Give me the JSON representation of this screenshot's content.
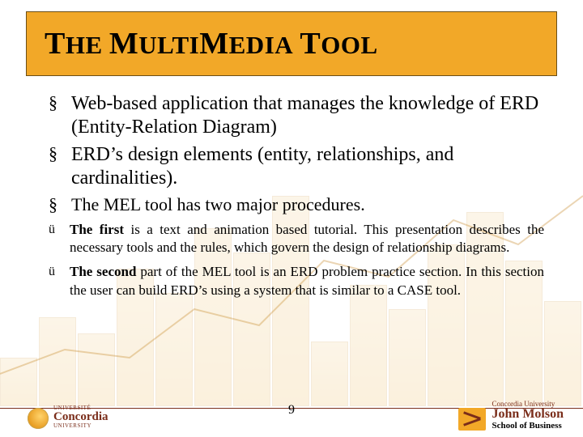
{
  "title_plain": "THE MULTIMEDIA TOOL",
  "bullets_main": [
    "Web-based application that manages the knowledge of ERD (Entity-Relation Diagram)",
    "ERD’s design elements (entity, relationships, and cardinalities)."
  ],
  "bullet_small": "The MEL tool has two major procedures.",
  "subpoints": [
    {
      "lead": "The first",
      "rest": " is a text and animation based tutorial. This presentation describes the necessary tools and the rules, which govern the design of relationship diagrams."
    },
    {
      "lead": "The second",
      "rest": " part of the MEL tool is an ERD problem practice section. In this section the user can build ERD’s using a system that is similar to a CASE tool."
    }
  ],
  "page_number": "9",
  "logo_left": {
    "top": "UNIVERSITÉ",
    "name": "Concordia",
    "sub": "UNIVERSITY"
  },
  "logo_right": {
    "line1": "Concordia University",
    "line2": "John Molson",
    "line3": "School of Business"
  },
  "colors": {
    "accent": "#f2a828",
    "brand": "#7a2d1a"
  },
  "bg_bar_heights": [
    60,
    110,
    90,
    170,
    140,
    220,
    190,
    260,
    80,
    150,
    120,
    200,
    240,
    180,
    130
  ]
}
